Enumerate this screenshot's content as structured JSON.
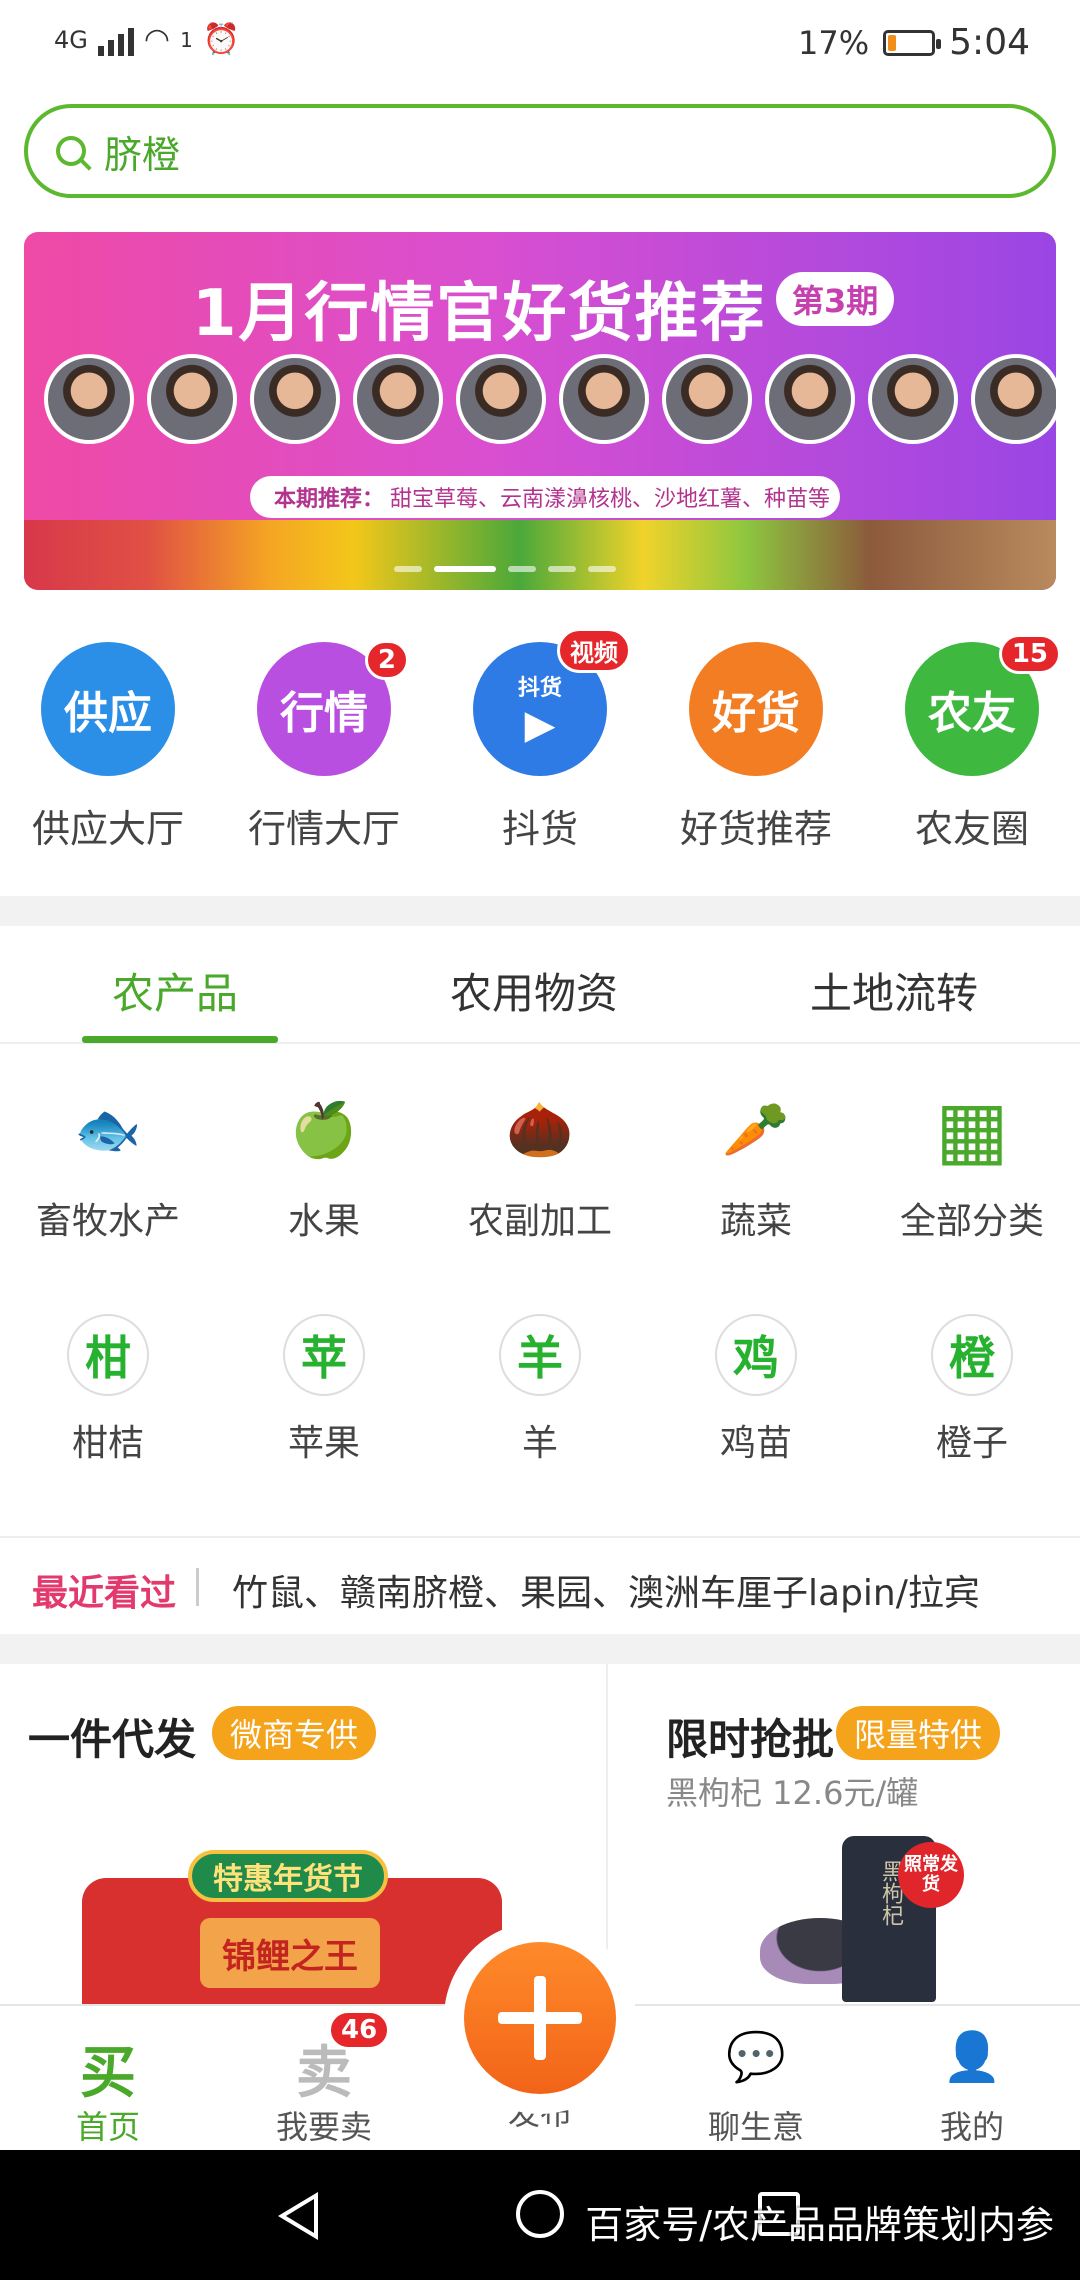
{
  "status_bar": {
    "network": "4G",
    "wifi_sup": "1",
    "battery_pct": "17%",
    "battery_level": 0.17,
    "time": "5:04"
  },
  "search": {
    "value": "脐橙",
    "icon": "search-icon"
  },
  "banner": {
    "title": "1月行情官好货推荐",
    "issue": "第3期",
    "rec_label": "本期推荐：",
    "rec_text": "甜宝草莓、云南漾濞核桃、沙地红薯、种苗等",
    "slide_count": 5,
    "active_slide": 2
  },
  "quick_entries": [
    {
      "icon_text": "供应",
      "label": "供应大厅",
      "color": "#2b8fe8",
      "badge": ""
    },
    {
      "icon_text": "行情",
      "label": "行情大厅",
      "color": "#b94fe0",
      "badge": "2"
    },
    {
      "icon_text": "抖货",
      "label": "抖货",
      "color": "#2e7be6",
      "badge": "视频"
    },
    {
      "icon_text": "好货",
      "label": "好货推荐",
      "color": "#f37d22",
      "badge": ""
    },
    {
      "icon_text": "农友",
      "label": "农友圈",
      "color": "#3fb840",
      "badge": "15"
    }
  ],
  "tabs": [
    {
      "label": "农产品",
      "active": true
    },
    {
      "label": "农用物资",
      "active": false
    },
    {
      "label": "土地流转",
      "active": false
    }
  ],
  "categories": [
    {
      "label": "畜牧水产",
      "icon": "fish-icon",
      "glyph": "🐟"
    },
    {
      "label": "水果",
      "icon": "apple-icon",
      "glyph": "🍏"
    },
    {
      "label": "农副加工",
      "icon": "acorn-icon",
      "glyph": "🌰"
    },
    {
      "label": "蔬菜",
      "icon": "carrot-icon",
      "glyph": "🥕"
    },
    {
      "label": "全部分类",
      "icon": "grid-icon",
      "glyph": "▦"
    }
  ],
  "hot_items": [
    {
      "char": "柑",
      "label": "柑桔"
    },
    {
      "char": "苹",
      "label": "苹果"
    },
    {
      "char": "羊",
      "label": "羊"
    },
    {
      "char": "鸡",
      "label": "鸡苗"
    },
    {
      "char": "橙",
      "label": "橙子"
    }
  ],
  "recent": {
    "heading": "最近看过",
    "items": "竹鼠、赣南脐橙、果园、澳洲车厘子lapin/拉宾"
  },
  "promo_left": {
    "title": "一件代发",
    "tag": "微商专供",
    "lantern_top": "特惠年货节",
    "lantern_mid": "锦鲤之王"
  },
  "promo_right": {
    "title": "限时抢批",
    "tag": "限量特供",
    "subtitle": "黑枸杞 12.6元/罐",
    "jar_label": "黑枸杞",
    "stamp": "照常发货"
  },
  "bottom_nav": [
    {
      "icon_char": "买",
      "label": "首页",
      "active": true,
      "badge": ""
    },
    {
      "icon_char": "卖",
      "label": "我要卖",
      "active": false,
      "badge": "46"
    },
    {
      "icon_char": "",
      "label": "发布",
      "active": false,
      "badge": ""
    },
    {
      "icon_char": "💬",
      "label": "聊生意",
      "active": false,
      "badge": ""
    },
    {
      "icon_char": "👤",
      "label": "我的",
      "active": false,
      "badge": ""
    }
  ],
  "watermark": "百家号/农产品品牌策划内参",
  "colors": {
    "accent": "#4aa82a",
    "badge": "#e5262a",
    "publish": "#f26418",
    "tag": "#f5a31a"
  }
}
